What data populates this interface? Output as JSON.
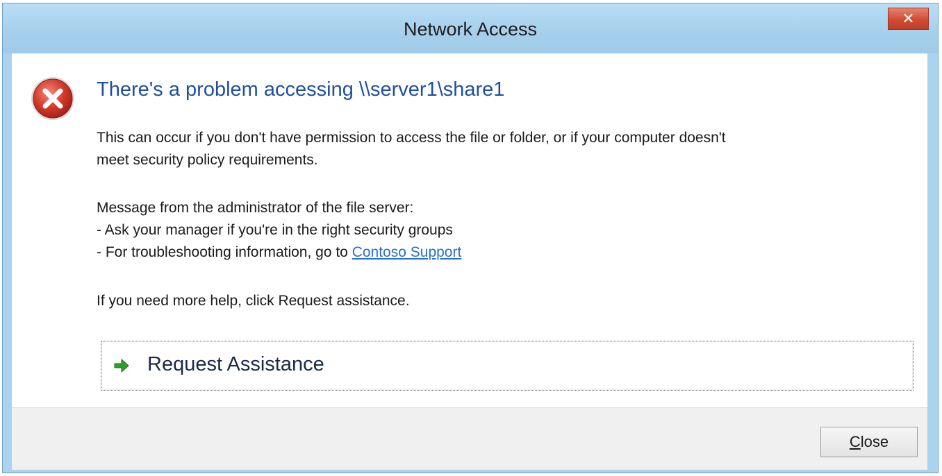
{
  "window": {
    "title": "Network Access",
    "close_glyph": "✕"
  },
  "dialog": {
    "icon": "error-icon",
    "heading": "There's a problem accessing \\\\server1\\share1",
    "description_line1": "This can occur if you don't have permission to access the file or folder, or if your computer doesn't",
    "description_line2": "meet security policy requirements.",
    "admin_message_header": "Message from the administrator of the file server:",
    "admin_message_line1": "- Ask your manager if you're in the right security groups",
    "admin_message_line2_prefix": "- For troubleshooting information, go to ",
    "admin_message_link": "Contoso Support",
    "help_text": "If you need more help, click Request assistance.",
    "command_link_label": "Request Assistance",
    "command_link_icon": "green-arrow-icon"
  },
  "footer": {
    "close_button_mnemonic": "C",
    "close_button_rest": "lose"
  },
  "colors": {
    "frame": "#a9d3ee",
    "heading": "#1f4f9e",
    "link": "#2a6fcc",
    "close_red": "#cf4b35",
    "arrow_green": "#2f9e2a"
  }
}
